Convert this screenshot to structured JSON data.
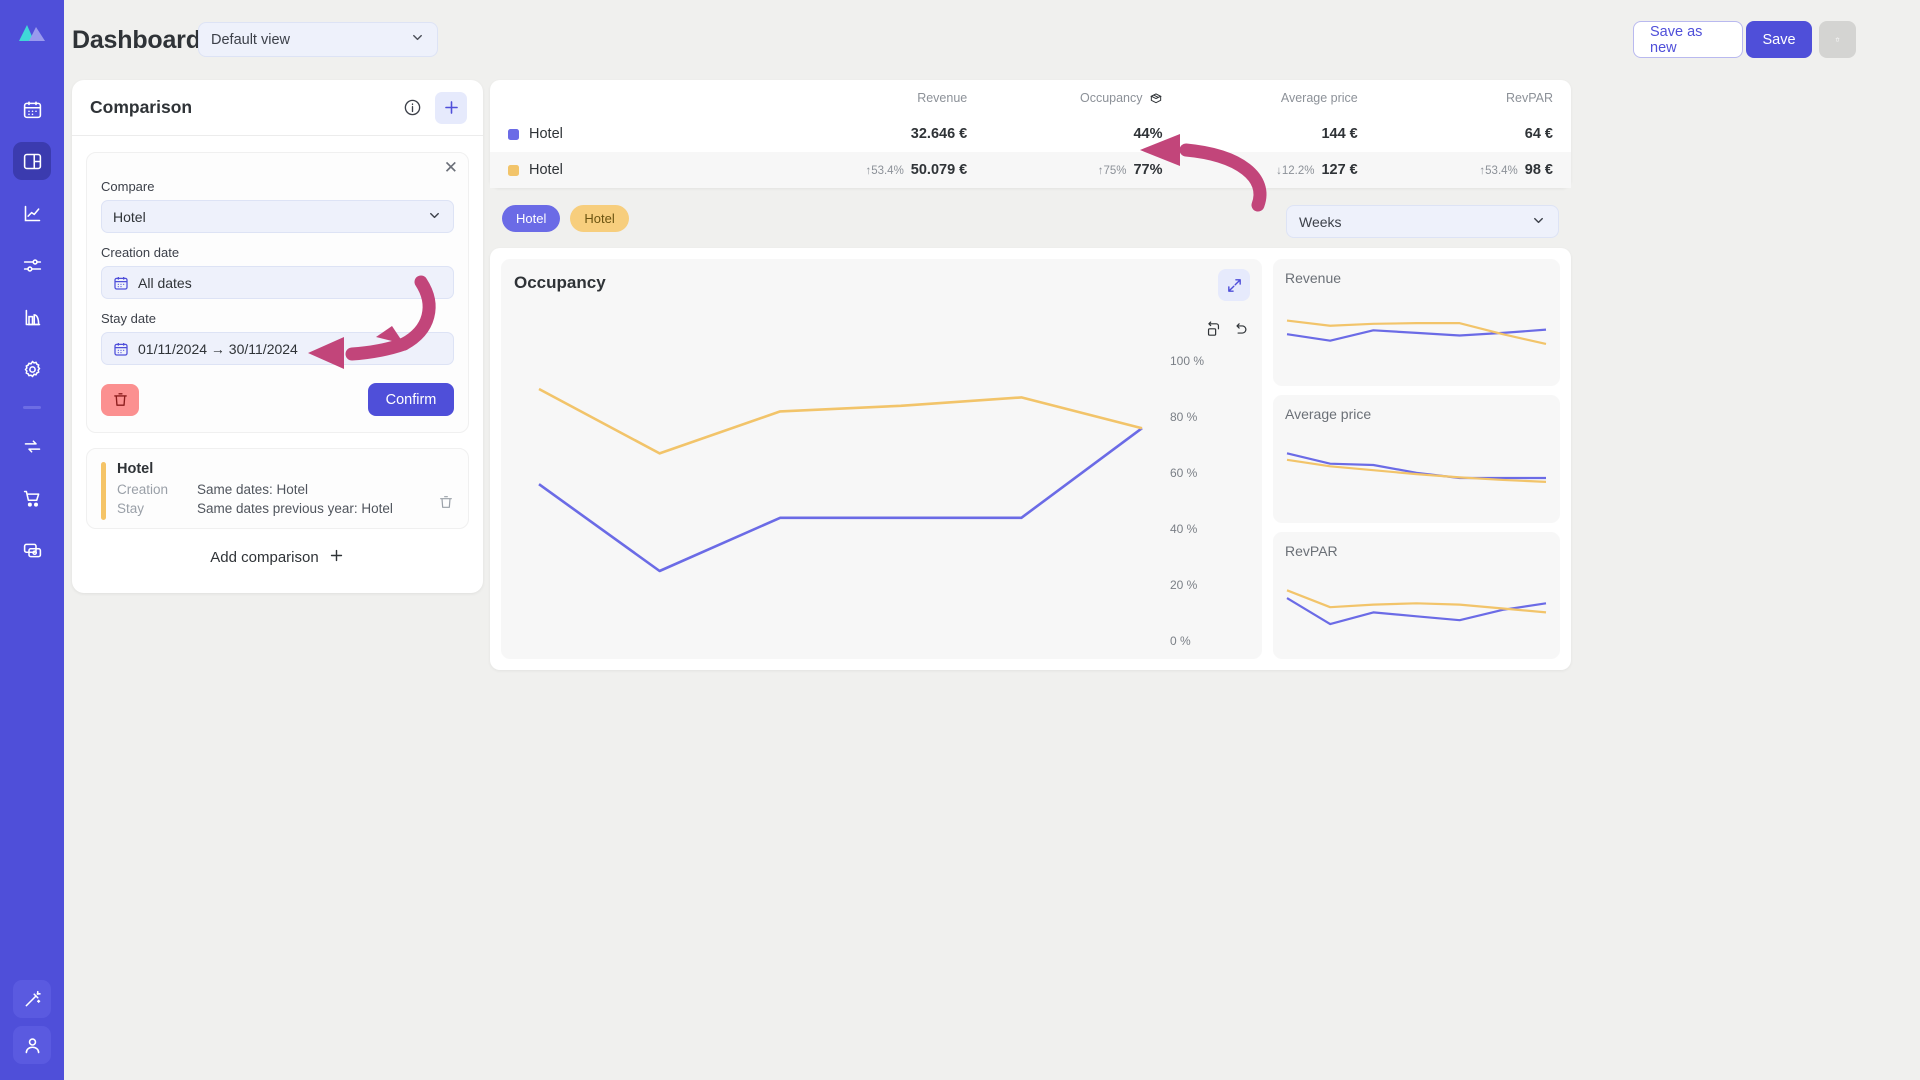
{
  "app": {
    "logo_icon": "mountain-logo-icon",
    "accent": "#4f4fd9",
    "series_blue": "#6b6be6",
    "series_yellow": "#f2c46a",
    "annotation_color": "#c2457a"
  },
  "sidebar": {
    "items": [
      {
        "icon": "calendar-icon",
        "name": "sidebar-item-calendar",
        "active": false
      },
      {
        "icon": "dashboard-icon",
        "name": "sidebar-item-dashboard",
        "active": true
      },
      {
        "icon": "analytics-chart-icon",
        "name": "sidebar-item-analytics",
        "active": false
      },
      {
        "icon": "sliders-icon",
        "name": "sidebar-item-settings-sliders",
        "active": false
      },
      {
        "icon": "bar-chart-icon",
        "name": "sidebar-item-reports",
        "active": false
      },
      {
        "icon": "gear-icon",
        "name": "sidebar-item-configuration",
        "active": false
      },
      {
        "icon": "divider",
        "name": "sidebar-divider",
        "active": false
      },
      {
        "icon": "sync-icon",
        "name": "sidebar-item-sync",
        "active": false
      },
      {
        "icon": "cart-icon",
        "name": "sidebar-item-sales",
        "active": false
      },
      {
        "icon": "money-icon",
        "name": "sidebar-item-billing",
        "active": false
      }
    ],
    "bottom_items": [
      {
        "icon": "magic-wand-icon",
        "name": "sidebar-item-assistant"
      },
      {
        "icon": "user-icon",
        "name": "sidebar-item-account"
      }
    ]
  },
  "header": {
    "title": "Dashboard",
    "view_select": {
      "value": "Default view",
      "icon": "chevron-down-icon"
    },
    "save_as_new_label": "Save as new",
    "save_label": "Save",
    "delete_icon": "trash-icon"
  },
  "comparison": {
    "title": "Comparison",
    "info_icon": "info-icon",
    "add_icon": "plus-icon",
    "editor": {
      "close_icon": "close-icon",
      "compare_label": "Compare",
      "compare_value": "Hotel",
      "creation_date_label": "Creation date",
      "creation_date_value": "All dates",
      "stay_date_label": "Stay date",
      "stay_date_value": "01/11/2024 → 30/11/2024",
      "calendar_icon": "calendar-icon",
      "chevron_icon": "chevron-down-icon",
      "delete_icon": "trash-icon",
      "confirm_label": "Confirm"
    },
    "saved": {
      "name": "Hotel",
      "rows": [
        {
          "key": "Creation",
          "value": "Same dates: Hotel"
        },
        {
          "key": "Stay",
          "value": "Same dates previous year: Hotel"
        }
      ],
      "delete_icon": "trash-icon",
      "accent_color": "#f5c467"
    },
    "add_comparison_label": "Add comparison",
    "add_comparison_icon": "plus-icon"
  },
  "kpi_table": {
    "columns": [
      "",
      "Revenue",
      "Occupancy",
      "Average price",
      "RevPAR"
    ],
    "occupancy_icon": "open-box-icon",
    "rows": [
      {
        "name": "Hotel",
        "color": "#6b6be6",
        "revenue": "32.646 €",
        "revenue_delta": "",
        "occupancy": "44%",
        "occupancy_delta": "",
        "average_price": "144 €",
        "average_price_delta": "",
        "revpar": "64 €",
        "revpar_delta": ""
      },
      {
        "name": "Hotel",
        "color": "#f2c46a",
        "revenue": "50.079 €",
        "revenue_delta": "↑53.4%",
        "occupancy": "77%",
        "occupancy_delta": "↑75%",
        "average_price": "127 €",
        "average_price_delta": "↓12.2%",
        "revpar": "98 €",
        "revpar_delta": "↑53.4%"
      }
    ]
  },
  "chips": [
    {
      "label": "Hotel",
      "style": "blue"
    },
    {
      "label": "Hotel",
      "style": "yellow"
    }
  ],
  "granularity": {
    "value": "Weeks",
    "icon": "chevron-down-icon"
  },
  "main_chart": {
    "title": "Occupancy",
    "expand_icon": "expand-arrows-icon",
    "reset_icon": "reset-zoom-icon",
    "undo_icon": "undo-icon"
  },
  "mini_charts": [
    {
      "title": "Revenue"
    },
    {
      "title": "Average price"
    },
    {
      "title": "RevPAR"
    }
  ],
  "chart_data": [
    {
      "type": "line",
      "name": "occupancy-main",
      "title": "Occupancy",
      "xlabel": "",
      "ylabel": "",
      "ylim": [
        0,
        110
      ],
      "yticks": [
        0,
        20,
        40,
        60,
        80,
        100
      ],
      "ytick_labels": [
        "0 %",
        "20 %",
        "40 %",
        "60 %",
        "80 %",
        "100 %"
      ],
      "grid": false,
      "legend": "chips-above",
      "x": [
        1,
        2,
        3,
        4,
        5,
        6
      ],
      "series": [
        {
          "name": "Hotel",
          "color": "#6b6be6",
          "values": [
            56,
            25,
            44,
            44,
            44,
            76
          ]
        },
        {
          "name": "Hotel",
          "color": "#f2c46a",
          "values": [
            90,
            67,
            82,
            84,
            87,
            76
          ]
        }
      ]
    },
    {
      "type": "line",
      "name": "revenue-mini",
      "title": "Revenue",
      "ylim": [
        0,
        100
      ],
      "grid": false,
      "x": [
        1,
        2,
        3,
        4,
        5,
        6,
        7
      ],
      "series": [
        {
          "name": "Hotel",
          "color": "#6b6be6",
          "values": [
            52,
            42,
            58,
            54,
            50,
            54,
            59
          ]
        },
        {
          "name": "Hotel",
          "color": "#f2c46a",
          "values": [
            73,
            65,
            68,
            69,
            69,
            52,
            37
          ]
        }
      ]
    },
    {
      "type": "line",
      "name": "average-price-mini",
      "title": "Average price",
      "ylim": [
        0,
        100
      ],
      "grid": false,
      "x": [
        1,
        2,
        3,
        4,
        5,
        6,
        7
      ],
      "series": [
        {
          "name": "Hotel",
          "color": "#6b6be6",
          "values": [
            78,
            62,
            60,
            48,
            40,
            40,
            40
          ]
        },
        {
          "name": "Hotel",
          "color": "#f2c46a",
          "values": [
            68,
            58,
            52,
            46,
            41,
            37,
            34
          ]
        }
      ]
    },
    {
      "type": "line",
      "name": "revpar-mini",
      "title": "RevPAR",
      "ylim": [
        0,
        100
      ],
      "grid": false,
      "x": [
        1,
        2,
        3,
        4,
        5,
        6,
        7
      ],
      "series": [
        {
          "name": "Hotel",
          "color": "#6b6be6",
          "values": [
            66,
            26,
            44,
            38,
            32,
            48,
            58
          ]
        },
        {
          "name": "Hotel",
          "color": "#f2c46a",
          "values": [
            78,
            52,
            56,
            58,
            56,
            50,
            44
          ]
        }
      ]
    }
  ],
  "annotations": [
    {
      "name": "arrow-to-stay-date",
      "color": "#c2457a"
    },
    {
      "name": "arrow-to-occupancy-value",
      "color": "#c2457a"
    }
  ]
}
